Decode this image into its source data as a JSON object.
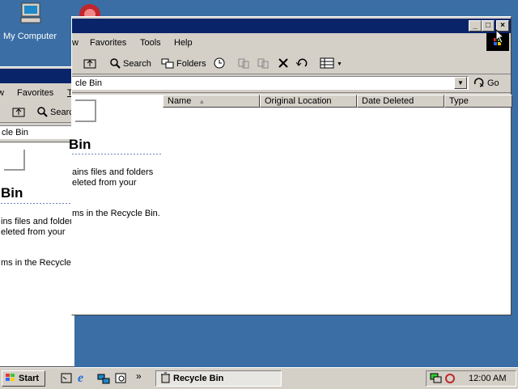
{
  "desktop": {
    "my_computer_label": "My Computer"
  },
  "front_window": {
    "menu": {
      "view_fragment": "w",
      "favorites": "Favorites",
      "tools": "Tools",
      "help": "Help"
    },
    "toolbar": {
      "search": "Search",
      "folders": "Folders"
    },
    "address": {
      "value": "cle Bin",
      "go": "Go"
    },
    "columns": [
      "Name",
      "Original Location",
      "Date Deleted",
      "Type"
    ],
    "panel": {
      "title": "Bin",
      "desc_line1": "ains files and folders",
      "desc_line2": "eleted from your",
      "items_text": "ms in the Recycle Bin."
    }
  },
  "back_window": {
    "menu": {
      "view_fragment": "w",
      "favorites": "Favorites",
      "tools": "T"
    },
    "toolbar": {
      "search": "Searc"
    },
    "address": {
      "value": "cle Bin"
    },
    "panel": {
      "title": "Bin",
      "desc_line1": "ins files and folders",
      "desc_line2": "eleted from your",
      "items_text": "ms in the Recycle B"
    }
  },
  "taskbar": {
    "start": "Start",
    "quicklaunch_more": "»",
    "task_recycle_bin": "Recycle Bin",
    "clock": "12:00 AM"
  },
  "colors": {
    "desktop": "#3a6ea5",
    "titlebar_active": "#0a246a",
    "titlebar_inactive": "#808080",
    "face": "#d4d0c8"
  }
}
